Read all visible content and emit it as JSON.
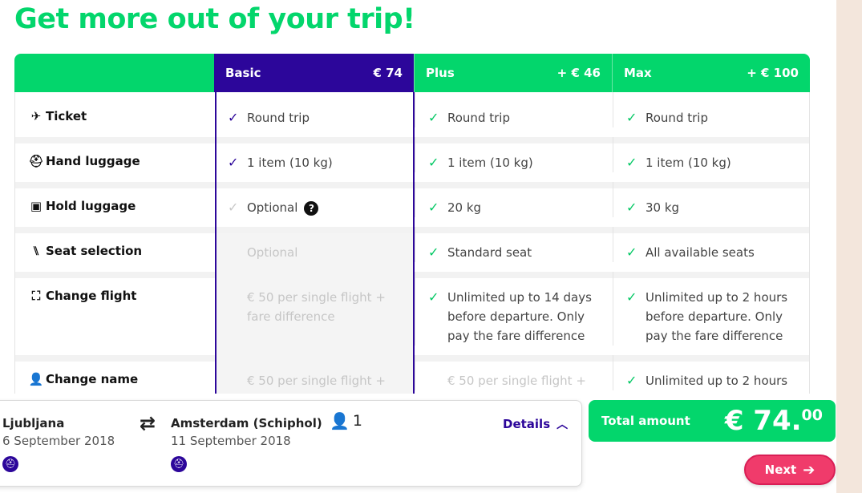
{
  "page": {
    "title": "Get more out of your trip!"
  },
  "header": {
    "basic": {
      "name": "Basic",
      "price": "€ 74"
    },
    "plus": {
      "name": "Plus",
      "price": "+ € 46"
    },
    "max": {
      "name": "Max",
      "price": "+ € 100"
    }
  },
  "rows": [
    {
      "label": "Ticket",
      "icon": "plane-icon",
      "basic": "Round trip",
      "plus": "Round trip",
      "max": "Round trip"
    },
    {
      "label": "Hand luggage",
      "icon": "backpack-icon",
      "basic": "1 item (10 kg)",
      "plus": "1 item (10 kg)",
      "max": "1 item (10 kg)"
    },
    {
      "label": "Hold luggage",
      "icon": "suitcase-icon",
      "basic": "Optional",
      "plus": "20 kg",
      "max": "30 kg"
    },
    {
      "label": "Seat selection",
      "icon": "seat-icon",
      "basic": "Optional",
      "plus": "Standard seat",
      "max": "All available seats"
    },
    {
      "label": "Change flight",
      "icon": "calendar-change-icon",
      "basic": "€ 50 per single flight + fare difference",
      "plus": "Unlimited up to 14 days before departure. Only pay the fare difference",
      "max": "Unlimited up to 2 hours before departure. Only pay the fare difference"
    },
    {
      "label": "Change name",
      "icon": "person-icon",
      "basic": "€ 50 per single flight +",
      "plus": "€ 50 per single flight +",
      "max": "Unlimited up to 2 hours"
    }
  ],
  "trip": {
    "origin_city": "Ljubljana",
    "origin_date": "6 September 2018",
    "dest_city": "Amsterdam (Schiphol)",
    "dest_date": "11 September 2018",
    "passengers": "1",
    "details_label": "Details"
  },
  "total": {
    "label": "Total amount",
    "amount": "€ 74.",
    "decimals": "00"
  },
  "next_label": "Next",
  "colors": {
    "green": "#03d66c",
    "purple": "#2c069a",
    "pink": "#f03b6b"
  }
}
